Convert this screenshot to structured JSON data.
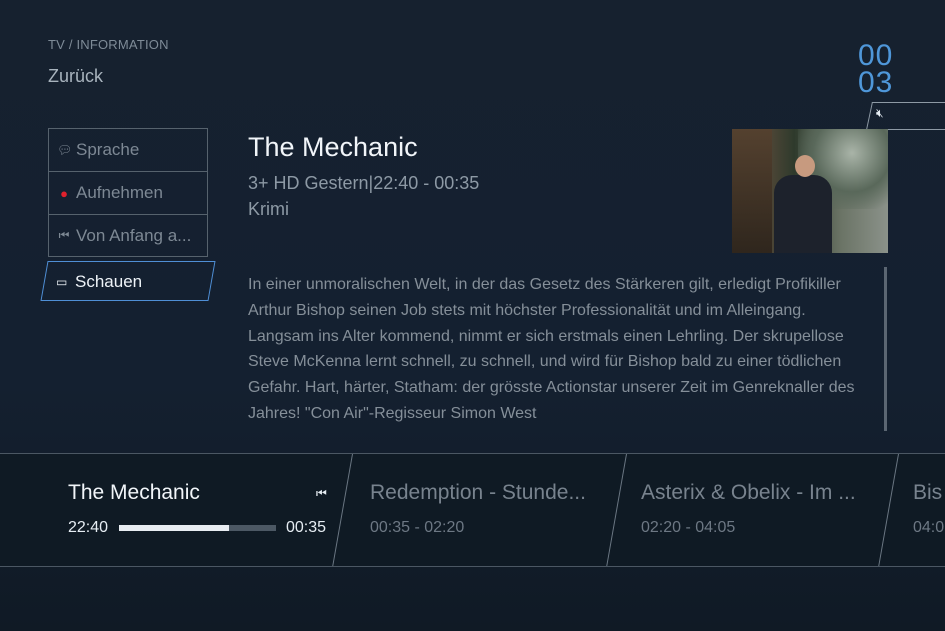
{
  "header": {
    "breadcrumb": "TV / INFORMATION",
    "back_label": "Zurück",
    "channel_line1": "00",
    "channel_line2": "03",
    "mute_icon": "speaker-mute-icon"
  },
  "menu": {
    "items": [
      {
        "label": "Sprache",
        "icon": "speech-bubble-icon"
      },
      {
        "label": "Aufnehmen",
        "icon": "record-dot-icon"
      },
      {
        "label": "Von Anfang a...",
        "icon": "restart-icon"
      }
    ],
    "active": {
      "label": "Schauen",
      "icon": "tv-screen-icon"
    }
  },
  "program": {
    "title": "The Mechanic",
    "meta": "3+ HD  Gestern|22:40 - 00:35",
    "genre": "Krimi",
    "description": "In einer unmoralischen Welt, in der das Gesetz des Stärkeren gilt, erledigt Profikiller Arthur Bishop seinen Job stets mit höchster Professionalität und im Alleingang. Langsam ins Alter kommend, nimmt er sich erstmals einen Lehrling. Der skrupellose Steve McKenna lernt schnell, zu schnell, und wird für Bishop bald zu einer tödlichen Gefahr. Hart, härter, Statham: der grösste Actionstar unserer Zeit im Genreknaller des Jahres! \"Con Air\"-Regisseur Simon West"
  },
  "timeline": {
    "current": {
      "title": "The Mechanic",
      "start": "22:40",
      "end": "00:35",
      "progress": 0.7,
      "icon": "restart-icon"
    },
    "next": [
      {
        "title": "Redemption - Stunde...",
        "time": "00:35 - 02:20"
      },
      {
        "title": "Asterix & Obelix - Im ...",
        "time": "02:20 - 04:05"
      },
      {
        "title": "Bis",
        "time": "04:0"
      }
    ]
  },
  "colors": {
    "accent": "#4f8fd6",
    "record": "#e0212d",
    "background": "#16212d"
  }
}
